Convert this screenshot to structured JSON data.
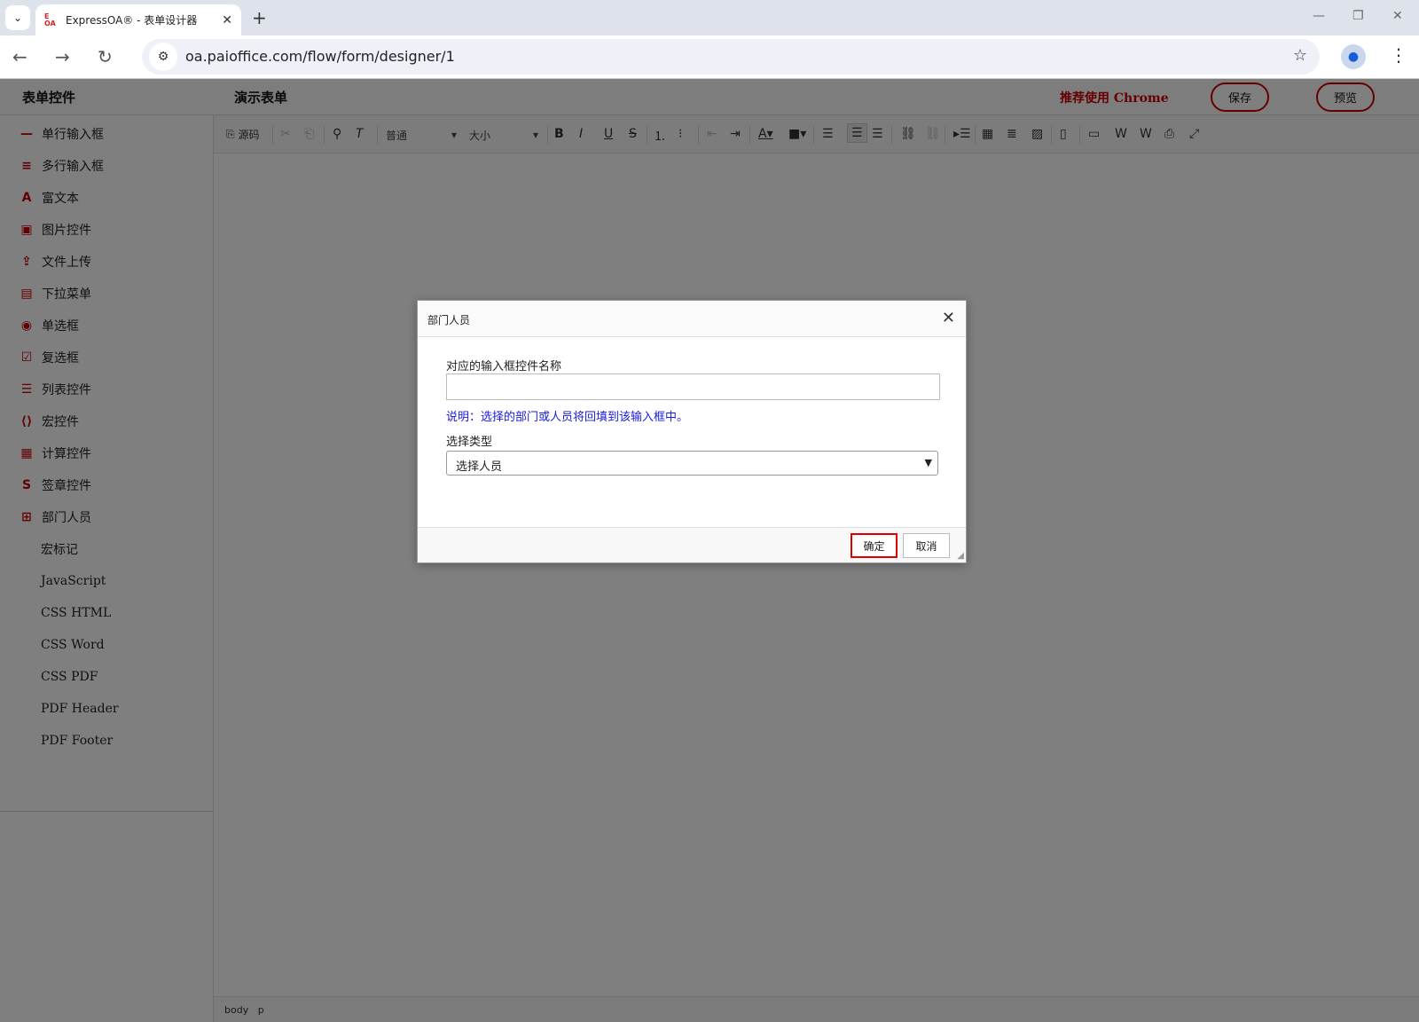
{
  "browser": {
    "tab_title": "ExpressOA® - 表单设计器",
    "url": "oa.paioffice.com/flow/form/designer/1"
  },
  "topbar": {
    "app_title": "表单控件",
    "form_title": "演示表单",
    "recommend": "推荐使用 Chrome",
    "save_label": "保存",
    "preview_label": "预览"
  },
  "sidebar": {
    "items": [
      {
        "label": "单行输入框",
        "icon": "single-line-icon"
      },
      {
        "label": "多行输入框",
        "icon": "multi-line-icon"
      },
      {
        "label": "富文本",
        "icon": "rich-text-icon"
      },
      {
        "label": "图片控件",
        "icon": "image-icon"
      },
      {
        "label": "文件上传",
        "icon": "file-upload-icon"
      },
      {
        "label": "下拉菜单",
        "icon": "dropdown-icon"
      },
      {
        "label": "单选框",
        "icon": "radio-icon"
      },
      {
        "label": "复选框",
        "icon": "checkbox-icon"
      },
      {
        "label": "列表控件",
        "icon": "list-icon"
      },
      {
        "label": "宏控件",
        "icon": "macro-icon"
      },
      {
        "label": "计算控件",
        "icon": "calculator-icon"
      },
      {
        "label": "签章控件",
        "icon": "signature-icon"
      },
      {
        "label": "部门人员",
        "icon": "dept-user-icon"
      },
      {
        "label": "宏标记",
        "icon": ""
      },
      {
        "label": "JavaScript",
        "icon": ""
      },
      {
        "label": "CSS HTML",
        "icon": ""
      },
      {
        "label": "CSS Word",
        "icon": ""
      },
      {
        "label": "CSS PDF",
        "icon": ""
      },
      {
        "label": "PDF Header",
        "icon": ""
      },
      {
        "label": "PDF Footer",
        "icon": ""
      }
    ]
  },
  "editor": {
    "source_label": "源码",
    "format_combo": "普通",
    "size_combo": "大小",
    "status_path": [
      "body",
      "p"
    ]
  },
  "dialog": {
    "title": "部门人员",
    "field_label": "对应的输入框控件名称",
    "field_value": "",
    "help_text": "说明：选择的部门或人员将回填到该输入框中。",
    "type_label": "选择类型",
    "type_selected": "选择人员",
    "ok_label": "确定",
    "cancel_label": "取消"
  },
  "colors": {
    "accent": "#cc0000",
    "help_text": "#1a1adf"
  }
}
